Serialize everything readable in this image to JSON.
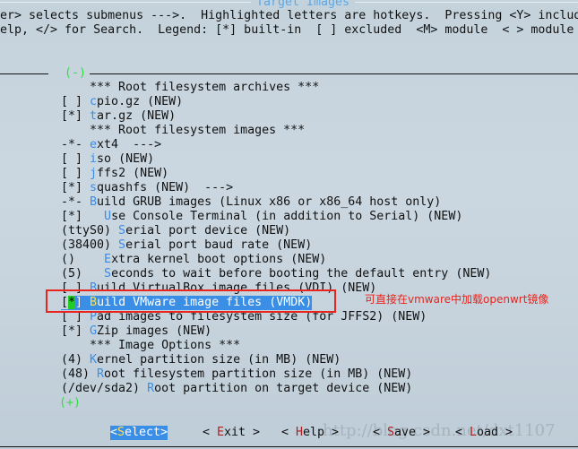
{
  "title": "Target Images",
  "help_lines": [
    "er> selects submenus --->.  Highlighted letters are hotkeys.  Pressing <Y> include",
    "elp, </> for Search.  Legend: [*] built-in  [ ] excluded  <M> module  < > module c"
  ],
  "scroll_top": "(-)",
  "scroll_bottom": "(+)",
  "items": [
    {
      "prefix": "    *** Root filesystem archives ***",
      "hot": "",
      "rest": ""
    },
    {
      "prefix": "[ ] ",
      "hot": "c",
      "rest": "pio.gz (NEW)"
    },
    {
      "prefix": "[*] ",
      "hot": "t",
      "rest": "ar.gz (NEW)"
    },
    {
      "prefix": "    *** Root filesystem images ***",
      "hot": "",
      "rest": ""
    },
    {
      "prefix": "-*- ",
      "hot": "e",
      "rest": "xt4  --->"
    },
    {
      "prefix": "[ ] ",
      "hot": "i",
      "rest": "so (NEW)"
    },
    {
      "prefix": "[ ] ",
      "hot": "j",
      "rest": "ffs2 (NEW)"
    },
    {
      "prefix": "[*] ",
      "hot": "s",
      "rest": "quashfs (NEW)  --->"
    },
    {
      "prefix": "-*- ",
      "hot": "B",
      "rest": "uild GRUB images (Linux x86 or x86_64 host only)"
    },
    {
      "prefix": "[*]   ",
      "hot": "U",
      "rest": "se Console Terminal (in addition to Serial) (NEW)"
    },
    {
      "prefix": "(ttyS0) ",
      "hot": "S",
      "rest": "erial port device (NEW)"
    },
    {
      "prefix": "(38400) ",
      "hot": "S",
      "rest": "erial port baud rate (NEW)"
    },
    {
      "prefix": "()    ",
      "hot": "E",
      "rest": "xtra kernel boot options (NEW)"
    },
    {
      "prefix": "(5)   ",
      "hot": "S",
      "rest": "econds to wait before booting the default entry (NEW)"
    },
    {
      "prefix": "[ ] ",
      "hot": "B",
      "rest": "uild VirtualBox image files (VDI) (NEW)"
    },
    {
      "prefix": "[*] ",
      "hot": "B",
      "rest": "uild VMware image files (VMDK)",
      "selected": true
    },
    {
      "prefix": "[ ] ",
      "hot": "P",
      "rest": "ad images to filesystem size (for JFFS2) (NEW)"
    },
    {
      "prefix": "[*] ",
      "hot": "G",
      "rest": "Zip images (NEW)"
    },
    {
      "prefix": "    *** Image Options ***",
      "hot": "",
      "rest": ""
    },
    {
      "prefix": "(4) ",
      "hot": "K",
      "rest": "ernel partition size (in MB) (NEW)"
    },
    {
      "prefix": "(48) ",
      "hot": "R",
      "rest": "oot filesystem partition size (in MB) (NEW)"
    },
    {
      "prefix": "(/dev/sda2) ",
      "hot": "R",
      "rest": "oot partition on target device (NEW)"
    }
  ],
  "annotation": "可直接在vmware中加载openwrt镜像",
  "buttons": [
    {
      "pre": "<",
      "hk": "S",
      "post": "elect>"
    },
    {
      "pre": "< ",
      "hk": "E",
      "post": "xit >"
    },
    {
      "pre": "< ",
      "hk": "H",
      "post": "elp >"
    },
    {
      "pre": "< ",
      "hk": "S",
      "post": "ave >"
    },
    {
      "pre": "< ",
      "hk": "L",
      "post": "oad >"
    }
  ],
  "watermark": "http://blog.csdn.net/dxt1107",
  "colors": {
    "hotkey": "#3a8ee6",
    "selection": "#3a8ee6",
    "annotation": "#e8241c",
    "scroll_indicator": "#33dd44"
  }
}
